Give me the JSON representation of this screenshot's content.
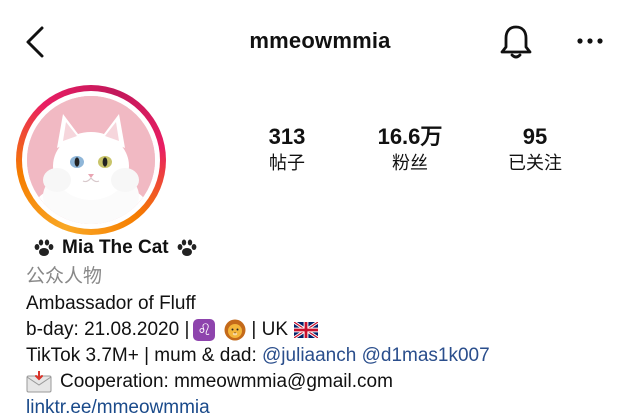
{
  "header": {
    "username": "mmeowmmia",
    "back_icon": "chevron-left-icon",
    "notification_icon": "bell-icon",
    "more_icon": "more-horizontal-icon"
  },
  "stats": [
    {
      "value": "313",
      "label": "帖子"
    },
    {
      "value": "16.6万",
      "label": "粉丝"
    },
    {
      "value": "95",
      "label": "已关注"
    }
  ],
  "bio": {
    "display_name": "Mia The Cat",
    "category": "公众人物",
    "tagline": "Ambassador of Fluff",
    "birthday_prefix": "b-day: 21.08.2020 |",
    "birthday_suffix": "| UK",
    "tiktok_prefix": "TikTok 3.7M+ | mum & dad:",
    "mention_1": "@juliaanch",
    "mention_2": "@d1mas1k007",
    "cooperation": "Cooperation: mmeowmmia@gmail.com",
    "link": "linktr.ee/mmeowmmia"
  },
  "icons": {
    "paw": "paw-print-icon",
    "zodiac": "leo-zodiac-icon",
    "zodiac_glyph": "♌",
    "lion": "lion-face-icon",
    "flag": "uk-flag-icon",
    "envelope": "envelope-icon"
  },
  "colors": {
    "link": "#1a4a8a",
    "secondary_text": "#888888",
    "avatar_bg": "#f1b9c3"
  }
}
